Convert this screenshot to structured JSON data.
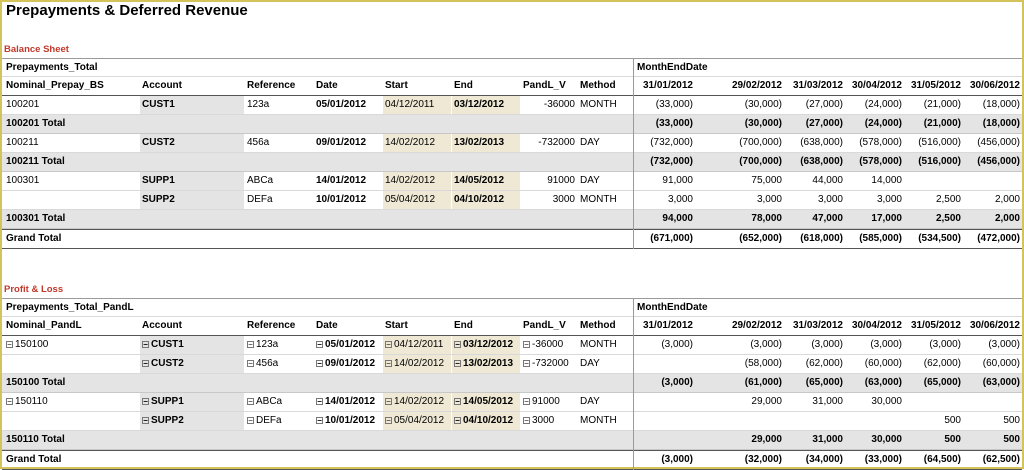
{
  "title": "Prepayments & Deferred Revenue",
  "balance_sheet": {
    "section_title": "Balance Sheet",
    "pivot_label": "Prepayments_Total",
    "column_field_label": "MonthEndDate",
    "headers": [
      "Nominal_Prepay_BS",
      "Account",
      "Reference",
      "Date",
      "Start",
      "End",
      "PandL_V",
      "Method"
    ],
    "months": [
      "31/01/2012",
      "29/02/2012",
      "31/03/2012",
      "30/04/2012",
      "31/05/2012",
      "30/06/2012"
    ],
    "rows": [
      {
        "type": "detail",
        "nominal": "100201",
        "account": "CUST1",
        "reference": "123a",
        "date": "05/01/2012",
        "start": "04/12/2011",
        "end": "03/12/2012",
        "pandl": "-36000",
        "method": "MONTH",
        "values": [
          "(33,000)",
          "(30,000)",
          "(27,000)",
          "(24,000)",
          "(21,000)",
          "(18,000)"
        ]
      },
      {
        "type": "total",
        "nominal": "100201 Total",
        "values": [
          "(33,000)",
          "(30,000)",
          "(27,000)",
          "(24,000)",
          "(21,000)",
          "(18,000)"
        ]
      },
      {
        "type": "detail",
        "nominal": "100211",
        "account": "CUST2",
        "reference": "456a",
        "date": "09/01/2012",
        "start": "14/02/2012",
        "end": "13/02/2013",
        "pandl": "-732000",
        "method": "DAY",
        "values": [
          "(732,000)",
          "(700,000)",
          "(638,000)",
          "(578,000)",
          "(516,000)",
          "(456,000)"
        ]
      },
      {
        "type": "total",
        "nominal": "100211 Total",
        "values": [
          "(732,000)",
          "(700,000)",
          "(638,000)",
          "(578,000)",
          "(516,000)",
          "(456,000)"
        ]
      },
      {
        "type": "detail",
        "nominal": "100301",
        "account": "SUPP1",
        "reference": "ABCa",
        "date": "14/01/2012",
        "start": "14/02/2012",
        "end": "14/05/2012",
        "pandl": "91000",
        "method": "DAY",
        "values": [
          "91,000",
          "75,000",
          "44,000",
          "14,000",
          "",
          ""
        ]
      },
      {
        "type": "detail",
        "nominal": "",
        "account": "SUPP2",
        "reference": "DEFa",
        "date": "10/01/2012",
        "start": "05/04/2012",
        "end": "04/10/2012",
        "pandl": "3000",
        "method": "MONTH",
        "values": [
          "3,000",
          "3,000",
          "3,000",
          "3,000",
          "2,500",
          "2,000"
        ]
      },
      {
        "type": "total",
        "nominal": "100301 Total",
        "values": [
          "94,000",
          "78,000",
          "47,000",
          "17,000",
          "2,500",
          "2,000"
        ]
      },
      {
        "type": "grand",
        "nominal": "Grand Total",
        "values": [
          "(671,000)",
          "(652,000)",
          "(618,000)",
          "(585,000)",
          "(534,500)",
          "(472,000)"
        ]
      }
    ]
  },
  "profit_loss": {
    "section_title": "Profit & Loss",
    "pivot_label": "Prepayments_Total_PandL",
    "column_field_label": "MonthEndDate",
    "headers": [
      "Nominal_PandL",
      "Account",
      "Reference",
      "Date",
      "Start",
      "End",
      "PandL_V",
      "Method"
    ],
    "months": [
      "31/01/2012",
      "29/02/2012",
      "31/03/2012",
      "30/04/2012",
      "31/05/2012",
      "30/06/2012"
    ],
    "rows": [
      {
        "type": "detail",
        "nominal": "150100",
        "account": "CUST1",
        "reference": "123a",
        "date": "05/01/2012",
        "start": "04/12/2011",
        "end": "03/12/2012",
        "pandl": "-36000",
        "method": "MONTH",
        "values": [
          "(3,000)",
          "(3,000)",
          "(3,000)",
          "(3,000)",
          "(3,000)",
          "(3,000)"
        ]
      },
      {
        "type": "detail",
        "nominal": "",
        "account": "CUST2",
        "reference": "456a",
        "date": "09/01/2012",
        "start": "14/02/2012",
        "end": "13/02/2013",
        "pandl": "-732000",
        "method": "DAY",
        "values": [
          "",
          "(58,000)",
          "(62,000)",
          "(60,000)",
          "(62,000)",
          "(60,000)"
        ]
      },
      {
        "type": "total",
        "nominal": "150100 Total",
        "values": [
          "(3,000)",
          "(61,000)",
          "(65,000)",
          "(63,000)",
          "(65,000)",
          "(63,000)"
        ]
      },
      {
        "type": "detail",
        "nominal": "150110",
        "account": "SUPP1",
        "reference": "ABCa",
        "date": "14/01/2012",
        "start": "14/02/2012",
        "end": "14/05/2012",
        "pandl": "91000",
        "method": "DAY",
        "values": [
          "",
          "29,000",
          "31,000",
          "30,000",
          "",
          ""
        ]
      },
      {
        "type": "detail",
        "nominal": "",
        "account": "SUPP2",
        "reference": "DEFa",
        "date": "10/01/2012",
        "start": "05/04/2012",
        "end": "04/10/2012",
        "pandl": "3000",
        "method": "MONTH",
        "values": [
          "",
          "",
          "",
          "",
          "500",
          "500"
        ]
      },
      {
        "type": "total",
        "nominal": "150110 Total",
        "values": [
          "",
          "29,000",
          "31,000",
          "30,000",
          "500",
          "500"
        ]
      },
      {
        "type": "grand",
        "nominal": "Grand Total",
        "values": [
          "(3,000)",
          "(32,000)",
          "(34,000)",
          "(33,000)",
          "(64,500)",
          "(62,500)"
        ]
      }
    ]
  }
}
